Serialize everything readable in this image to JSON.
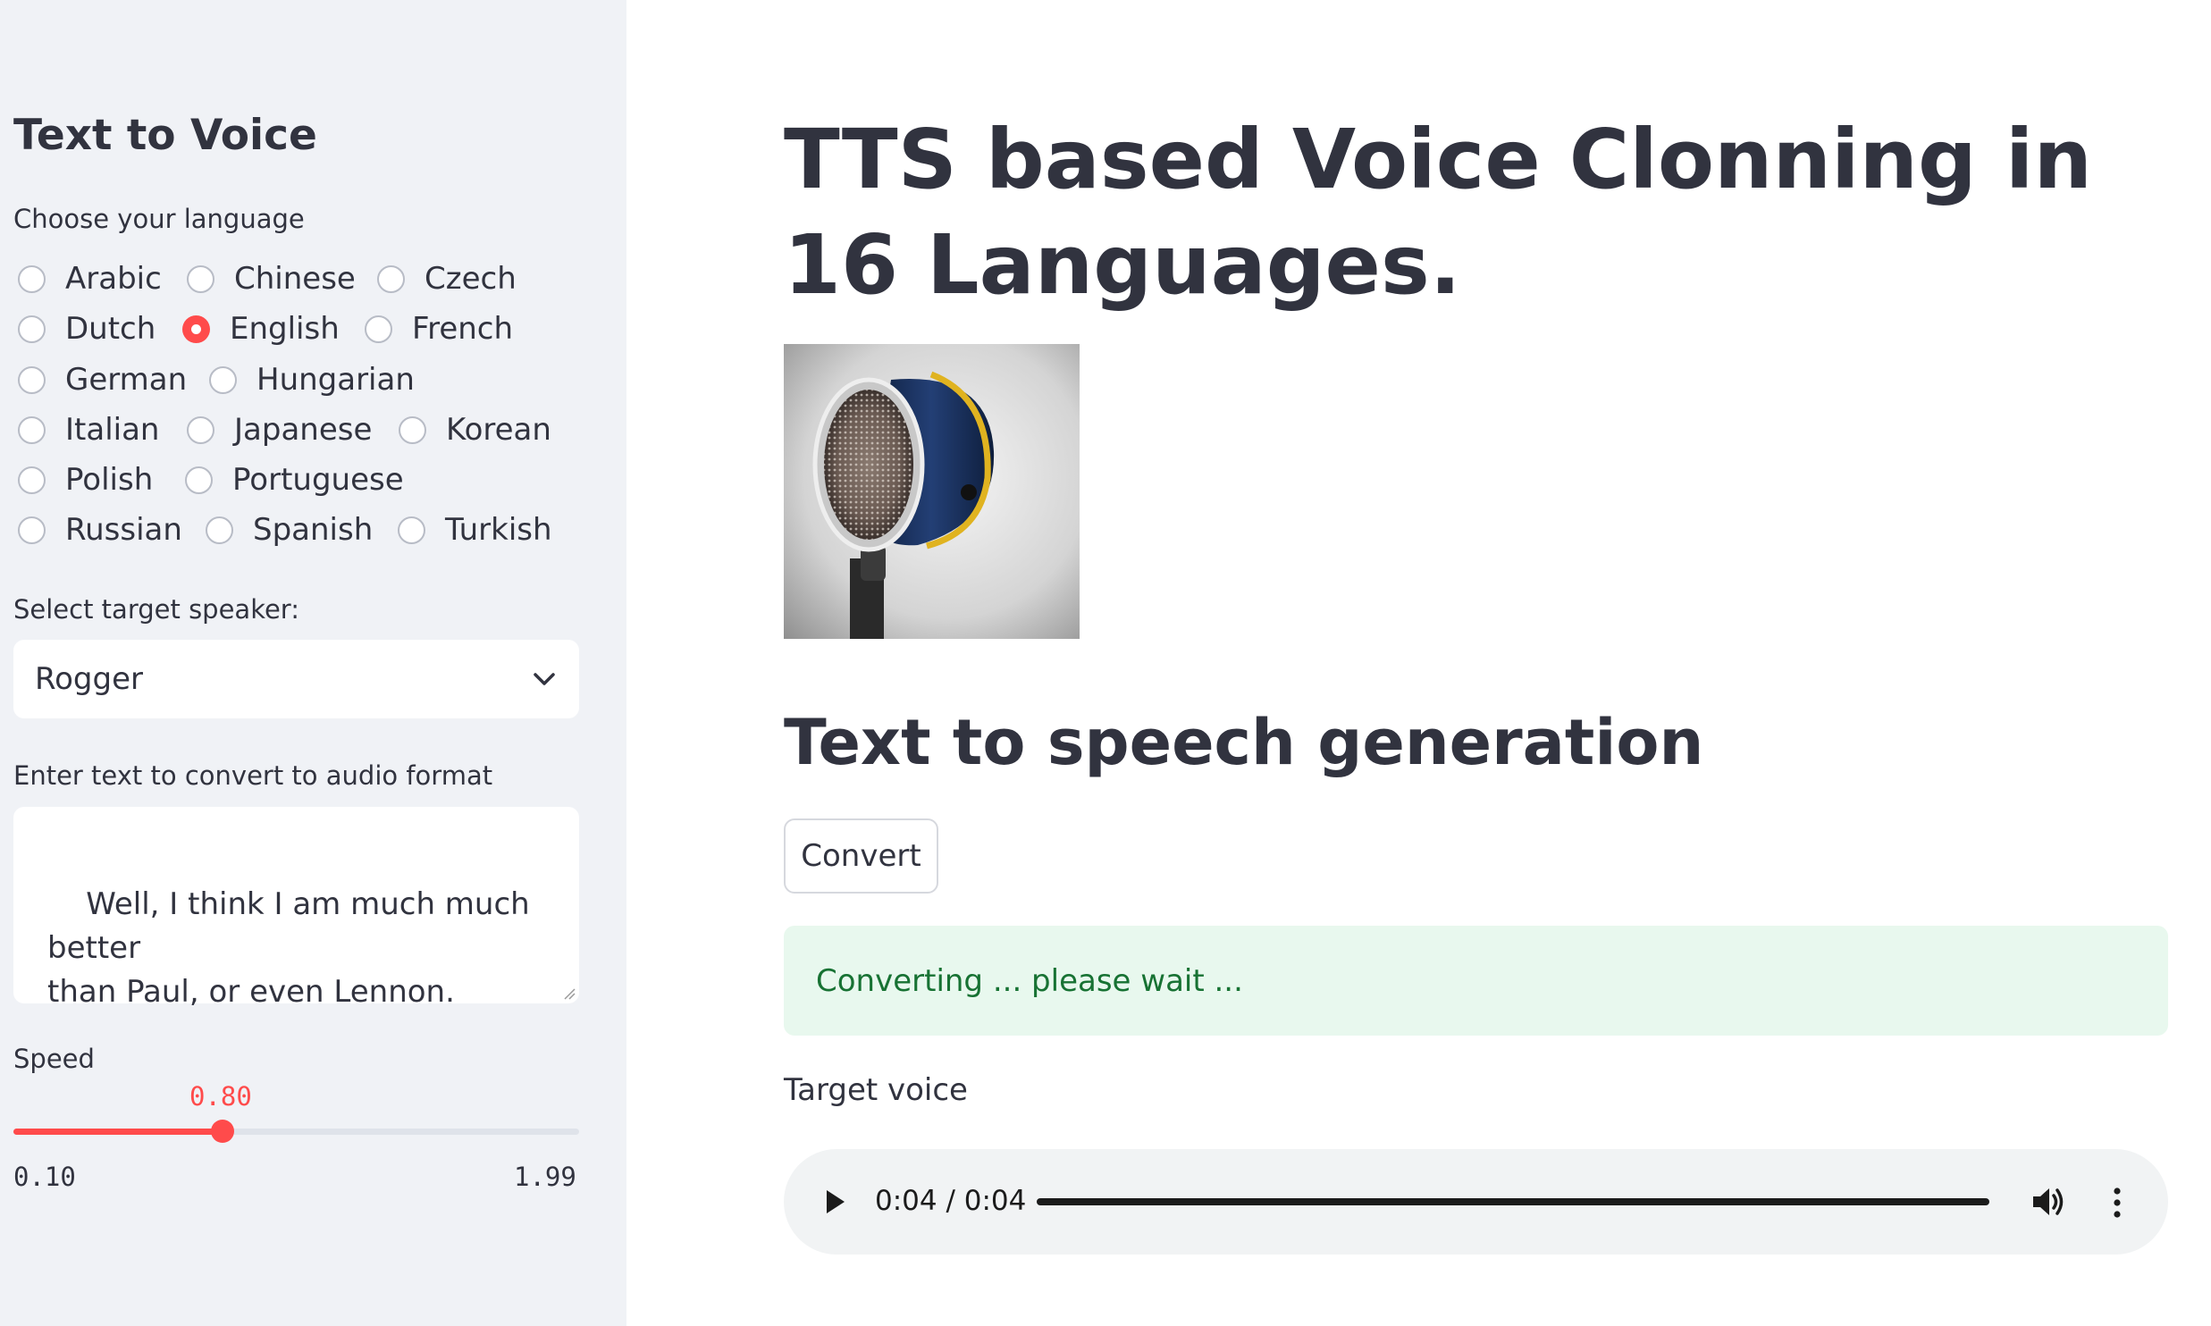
{
  "sidebar": {
    "title": "Text to Voice",
    "language_label": "Choose your language",
    "languages": [
      {
        "label": "Arabic",
        "checked": false
      },
      {
        "label": "Chinese",
        "checked": false
      },
      {
        "label": "Czech",
        "checked": false
      },
      {
        "label": "Dutch",
        "checked": false
      },
      {
        "label": "English",
        "checked": true
      },
      {
        "label": "French",
        "checked": false
      },
      {
        "label": "German",
        "checked": false
      },
      {
        "label": "Hungarian",
        "checked": false
      },
      {
        "label": "Italian",
        "checked": false
      },
      {
        "label": "Japanese",
        "checked": false
      },
      {
        "label": "Korean",
        "checked": false
      },
      {
        "label": "Polish",
        "checked": false
      },
      {
        "label": "Portuguese",
        "checked": false
      },
      {
        "label": "Russian",
        "checked": false
      },
      {
        "label": "Spanish",
        "checked": false
      },
      {
        "label": "Turkish",
        "checked": false
      }
    ],
    "speaker_label": "Select target speaker:",
    "speaker_value": "Rogger",
    "text_label": "Enter text to convert to audio format",
    "text_value": "Well, I think I am much much better\nthan Paul, or even Lennon.",
    "speed_label": "Speed",
    "speed_value": "0.80",
    "speed_min": "0.10",
    "speed_max": "1.99"
  },
  "main": {
    "title": "TTS based Voice Clonning in 16 Languages.",
    "section_title": "Text to speech generation",
    "convert_label": "Convert",
    "status_message": "Converting ... please wait ...",
    "audio_label": "Target voice",
    "audio_time": "0:04 / 0:04"
  },
  "colors": {
    "accent": "#ff4b4b",
    "sidebar_bg": "#f0f2f6",
    "success_bg": "#e8f8ee",
    "success_text": "#177233",
    "text": "#31333f"
  },
  "icons": [
    "chevron-down-icon",
    "play-icon",
    "volume-icon",
    "more-vert-icon",
    "microphone-image"
  ]
}
